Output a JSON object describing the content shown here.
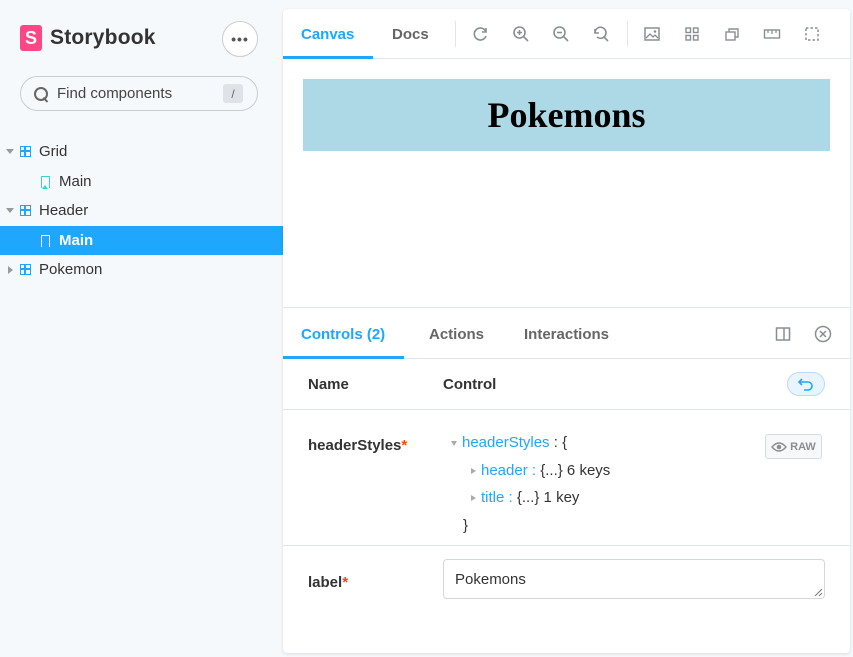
{
  "brand": {
    "name": "Storybook",
    "logo_letter": "S",
    "color": "#ff4785"
  },
  "search": {
    "placeholder": "Find components",
    "shortcut": "/"
  },
  "sidebar": {
    "items": [
      {
        "label": "Grid",
        "type": "component",
        "expanded": true
      },
      {
        "label": "Main",
        "type": "story",
        "selected": false
      },
      {
        "label": "Header",
        "type": "component",
        "expanded": true
      },
      {
        "label": "Main",
        "type": "story",
        "selected": true
      },
      {
        "label": "Pokemon",
        "type": "component",
        "expanded": false
      }
    ]
  },
  "toolbar": {
    "tabs": [
      {
        "label": "Canvas",
        "active": true
      },
      {
        "label": "Docs",
        "active": false
      }
    ],
    "icons": [
      "reload-icon",
      "zoom-in-icon",
      "zoom-out-icon",
      "zoom-reset-icon",
      "background-icon",
      "grid-icon",
      "viewport-icon",
      "measure-icon",
      "outline-icon"
    ]
  },
  "preview": {
    "title": "Pokemons",
    "background": "#add8e6"
  },
  "addons": {
    "tabs": [
      {
        "label": "Controls (2)",
        "active": true
      },
      {
        "label": "Actions",
        "active": false
      },
      {
        "label": "Interactions",
        "active": false
      }
    ]
  },
  "controls": {
    "headers": {
      "name": "Name",
      "control": "Control"
    },
    "rows": [
      {
        "name": "headerStyles",
        "required": "*",
        "json": {
          "root_key": "headerStyles",
          "root_open": " : {",
          "children": [
            {
              "key": "header",
              "sep": " : ",
              "value": "{...}",
              "count": " 6 keys"
            },
            {
              "key": "title",
              "sep": " : ",
              "value": "{...}",
              "count": " 1 key"
            }
          ],
          "close": "}"
        },
        "raw_label": "RAW"
      },
      {
        "name": "label",
        "required": "*",
        "value": "Pokemons"
      }
    ]
  },
  "accent": "#1ea7fd"
}
